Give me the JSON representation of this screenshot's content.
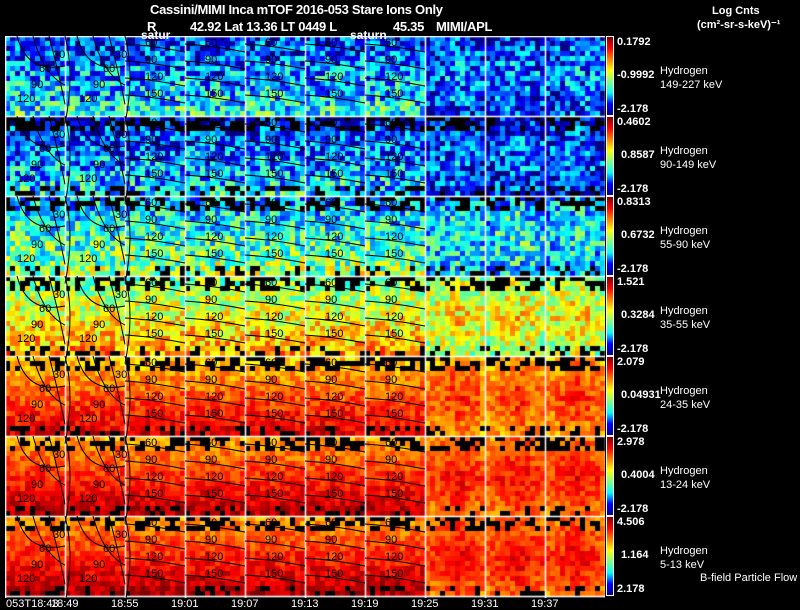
{
  "header": {
    "title": "Cassini/MIMI Inca mTOF  2016-053   Stare   Ions Only",
    "r_label": "R",
    "position_text": "42.92 Lat 13.36 LT 0449 L",
    "l_value": "45.35",
    "institution": "MIMI/APL",
    "units_line1": "Log Cnts",
    "units_line2": "(cm²-sr-s-keV)⁻¹"
  },
  "annotations": {
    "saturn_left": "satur",
    "saturn_right": "saturn",
    "footer": "B-field Particle Flow"
  },
  "chart_data": {
    "type": "heatmap",
    "colormap": "jet",
    "grid": true,
    "columns": [
      "053T18:43",
      "18:49",
      "18:55",
      "19:01",
      "19:07",
      "19:13",
      "19:19",
      "19:25",
      "19:31",
      "19:37"
    ],
    "contour_levels": [
      "30",
      "60",
      "90",
      "120",
      "150"
    ],
    "rows": [
      {
        "species": "Hydrogen",
        "energy": "149-227 keV",
        "max": "0.1792",
        "mid": "-0.9992",
        "min": "-2.178"
      },
      {
        "species": "Hydrogen",
        "energy": "90-149 keV",
        "max": "0.4602",
        "mid": "0.8587",
        "min": "-2.178"
      },
      {
        "species": "Hydrogen",
        "energy": "55-90 keV",
        "max": "0.8313",
        "mid": "0.6732",
        "min": "-2.178"
      },
      {
        "species": "Hydrogen",
        "energy": "35-55 keV",
        "max": "1.521",
        "mid": "0.3284",
        "min": "-2.178"
      },
      {
        "species": "Hydrogen",
        "energy": "24-35 keV",
        "max": "2.079",
        "mid": "0.04931",
        "min": "-2.178"
      },
      {
        "species": "Hydrogen",
        "energy": "13-24 keV",
        "max": "2.978",
        "mid": "0.4004",
        "min": "-2.178"
      },
      {
        "species": "Hydrogen",
        "energy": "5-13 keV",
        "max": "4.506",
        "mid": "1.164",
        "min": "2.178"
      }
    ]
  }
}
